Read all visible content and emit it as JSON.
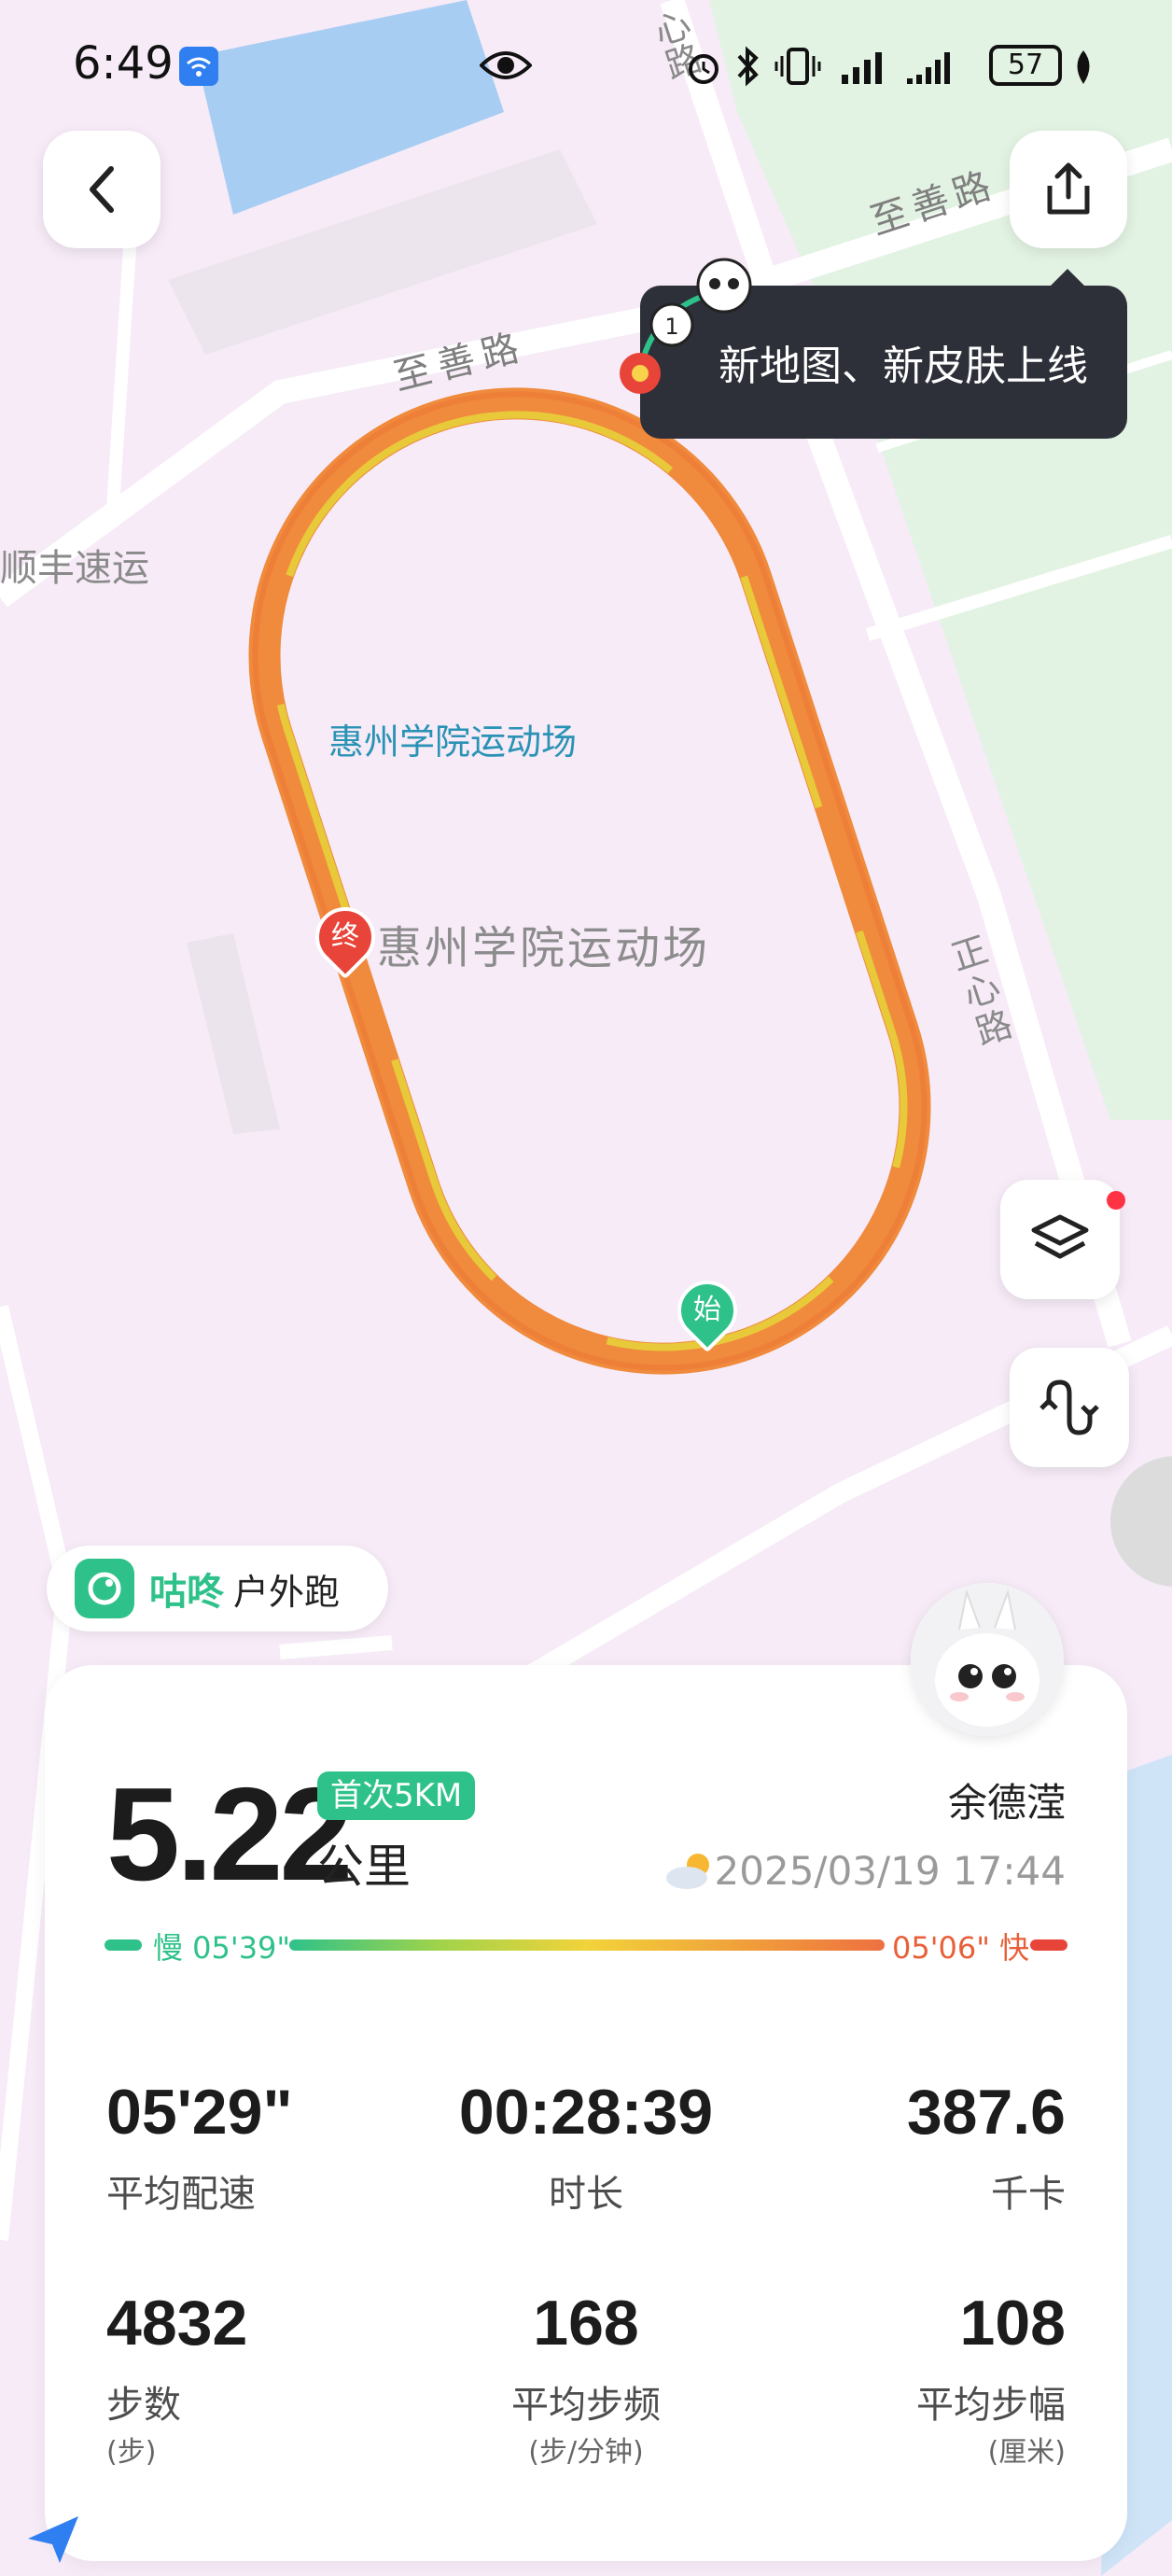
{
  "status_bar": {
    "time": "6:49",
    "battery": "57"
  },
  "map": {
    "road_top": "至善路",
    "road_mid": "至善路",
    "road_left": "顺丰速运",
    "road_right_top": "心路",
    "road_right": "正心路",
    "venue_label_blue": "惠州学院运动场",
    "venue_label_gray": "惠州学院运动场",
    "start_marker": "始",
    "end_marker": "终"
  },
  "tooltip": {
    "text": "新地图、新皮肤上线"
  },
  "app_pill": {
    "brand": "咕咚",
    "activity": "户外跑"
  },
  "summary": {
    "distance": "5.22",
    "unit": "公里",
    "badge": "首次5KM",
    "user": "余德滢",
    "datetime": "2025/03/19 17:44",
    "pace_slow": "慢 05'39\"",
    "pace_fast": "05'06\" 快"
  },
  "stats": [
    {
      "value": "05'29\"",
      "label": "平均配速",
      "unit": ""
    },
    {
      "value": "00:28:39",
      "label": "时长",
      "unit": ""
    },
    {
      "value": "387.6",
      "label": "千卡",
      "unit": ""
    },
    {
      "value": "4832",
      "label": "步数",
      "unit": "(步)"
    },
    {
      "value": "168",
      "label": "平均步频",
      "unit": "(步/分钟)"
    },
    {
      "value": "108",
      "label": "平均步幅",
      "unit": "(厘米)"
    }
  ],
  "colors": {
    "brand_green": "#2ec28a",
    "track_orange": "#f08a3c",
    "track_yellow": "#e8c93a",
    "end_red": "#e8443a"
  }
}
